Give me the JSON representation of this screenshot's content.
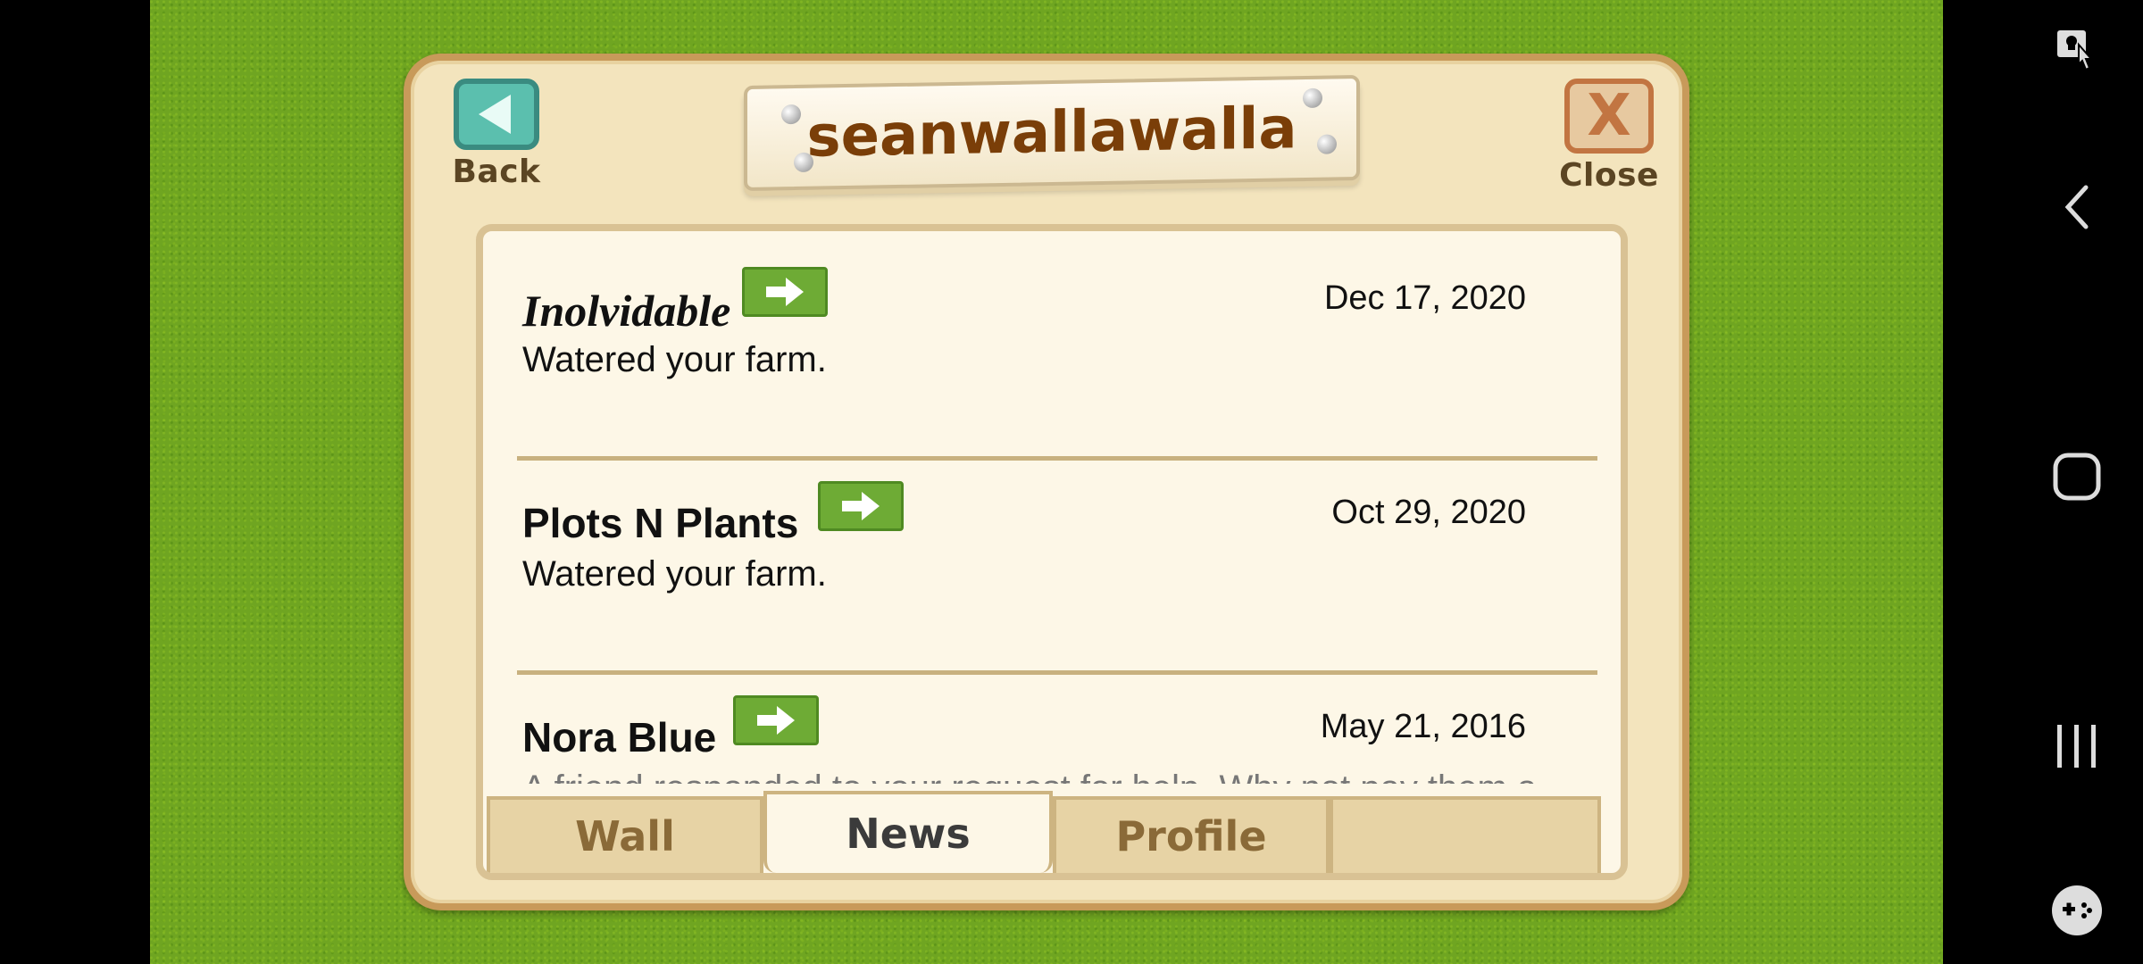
{
  "header": {
    "title": "seanwallawalla",
    "back_label": "Back",
    "close_label": "Close"
  },
  "feed": [
    {
      "name": "Inolvidable",
      "date": "Dec 17, 2020",
      "message": "Watered your farm."
    },
    {
      "name": "Plots N Plants",
      "date": "Oct 29, 2020",
      "message": "Watered your farm."
    },
    {
      "name": "Nora Blue",
      "date": "May 21, 2016",
      "message": "A friend responded to your request for help. Why not pay them a"
    }
  ],
  "tabs": [
    {
      "label": "Wall",
      "active": false
    },
    {
      "label": "News",
      "active": true
    },
    {
      "label": "Profile",
      "active": false
    },
    {
      "label": "",
      "active": false
    }
  ],
  "colors": {
    "field_green": "#6fa521",
    "panel_bg": "#f3e4bd",
    "panel_border": "#c89a5a",
    "title_text": "#7a3e08",
    "go_button": "#6eab35"
  }
}
